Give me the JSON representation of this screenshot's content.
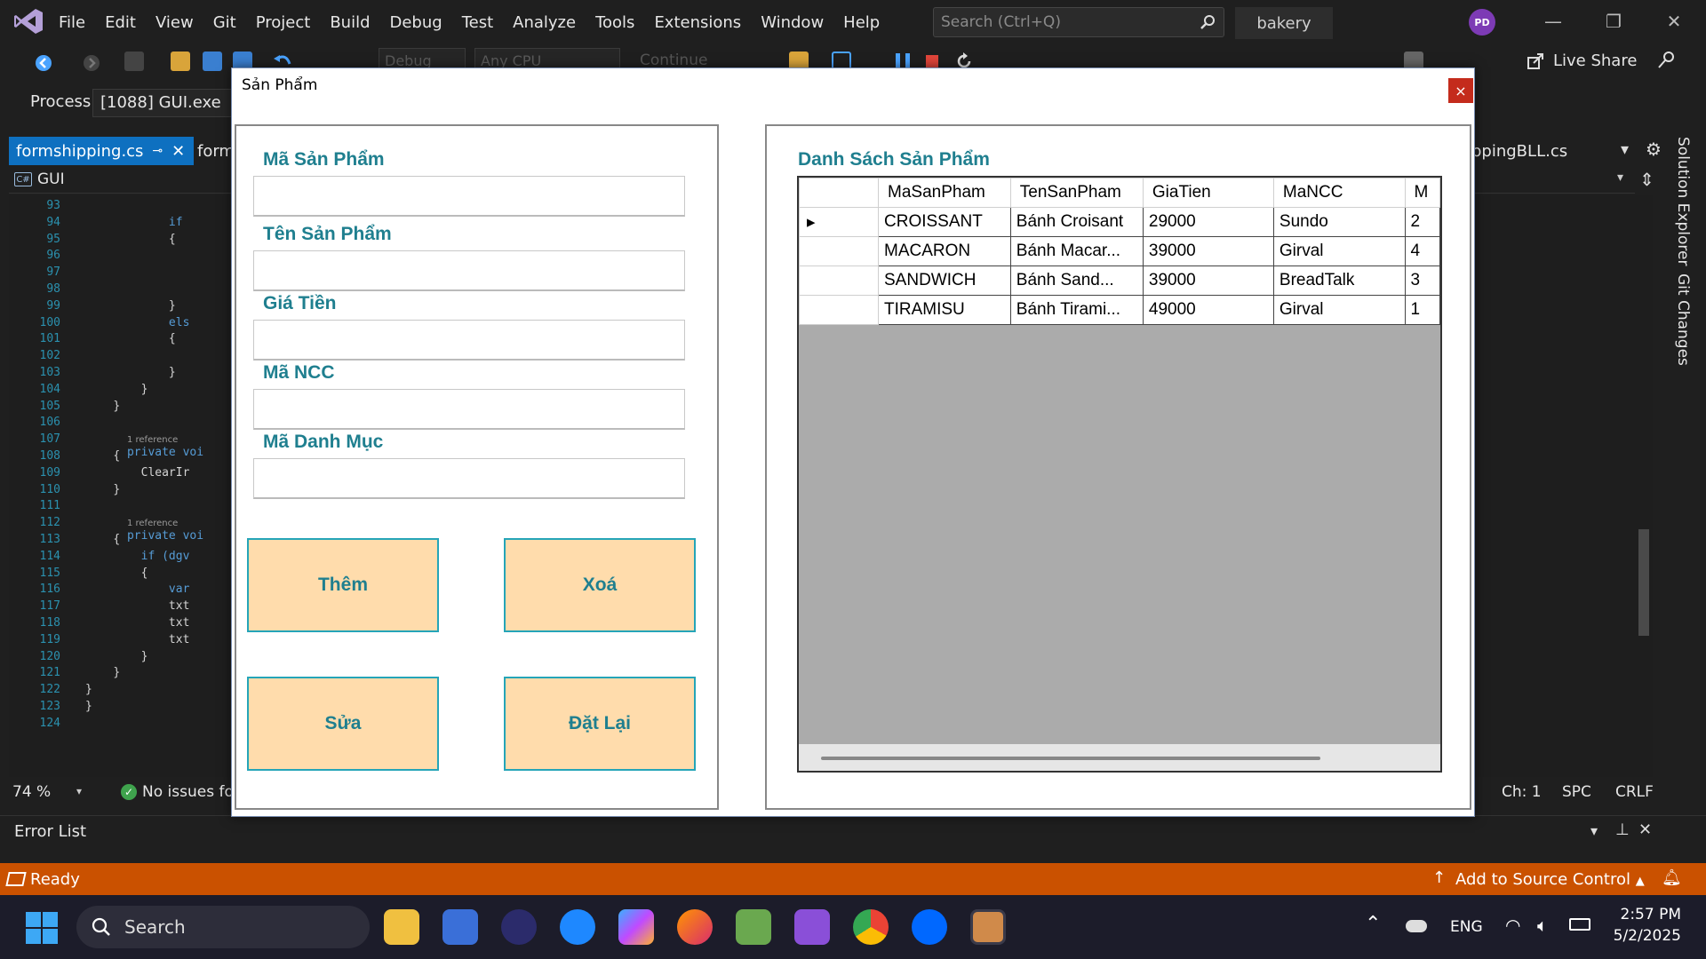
{
  "vs": {
    "menu": [
      "File",
      "Edit",
      "View",
      "Git",
      "Project",
      "Build",
      "Debug",
      "Test",
      "Analyze",
      "Tools",
      "Extensions",
      "Window",
      "Help"
    ],
    "search_placeholder": "Search (Ctrl+Q)",
    "solution_name": "bakery",
    "avatar_initials": "PD",
    "live_share": "Live Share",
    "toolbar_debug_combo": "Debug",
    "toolbar_cpu_combo": "Any CPU",
    "toolbar_continue": "Continue",
    "process_label": "Process:",
    "process_value": "[1088] GUI.exe",
    "active_tab": "formshipping.cs",
    "second_tab": "form",
    "right_tab": "ppingBLL.cs",
    "nav_project": "GUI",
    "line_numbers": [
      "93",
      "94",
      "95",
      "96",
      "97",
      "98",
      "99",
      "100",
      "101",
      "102",
      "103",
      "104",
      "105",
      "106",
      "107",
      "108",
      "109",
      "110",
      "111",
      "112",
      "113",
      "114",
      "115",
      "116",
      "117",
      "118",
      "119",
      "120",
      "121",
      "122",
      "123",
      "124"
    ],
    "code_fragments": {
      "if": "if",
      "else": "els",
      "reference": "1 reference",
      "private_void": "private voi",
      "clear": "ClearIr",
      "if_dgv": "if (dgv",
      "var": "var",
      "txt": "txt",
      "brace_open": "{",
      "brace_close": "}"
    },
    "zoom": "74 %",
    "no_issues": "No issues fou",
    "status_col": "Ch: 1",
    "status_spc": "SPC",
    "status_crlf": "CRLF",
    "side_tabs": [
      "Solution Explorer",
      "Git Changes"
    ],
    "error_list": "Error List",
    "status_ready": "Ready",
    "add_to_source_control": "Add to Source Control"
  },
  "taskbar": {
    "search": "Search",
    "lang": "ENG",
    "time": "2:57 PM",
    "date": "5/2/2025"
  },
  "dialog": {
    "title": "Sản Phẩm",
    "close": "×",
    "labels": {
      "ma_san_pham": "Mã Sản Phẩm",
      "ten_san_pham": "Tên Sản Phẩm",
      "gia_tien": "Giá Tiền",
      "ma_ncc": "Mã NCC",
      "ma_danh_muc": "Mã Danh Mục"
    },
    "inputs": {
      "ma_san_pham": "",
      "ten_san_pham": "",
      "gia_tien": "",
      "ma_ncc": "",
      "ma_danh_muc": ""
    },
    "buttons": {
      "them": "Thêm",
      "xoa": "Xoá",
      "sua": "Sửa",
      "dat_lai": "Đặt Lại"
    },
    "list_title": "Danh Sách Sản Phẩm",
    "grid": {
      "columns": [
        "MaSanPham",
        "TenSanPham",
        "GiaTien",
        "MaNCC",
        "M"
      ],
      "rows": [
        [
          "CROISSANT",
          "Bánh Croisant",
          "29000",
          "Sundo",
          "2"
        ],
        [
          "MACARON",
          "Bánh Macar...",
          "39000",
          "Girval",
          "4"
        ],
        [
          "SANDWICH",
          "Bánh Sand...",
          "39000",
          "BreadTalk",
          "3"
        ],
        [
          "TIRAMISU",
          "Bánh Tirami...",
          "49000",
          "Girval",
          "1"
        ]
      ],
      "current_row_marker": "▸"
    }
  },
  "colors": {
    "accent": "#0e70c0",
    "status_bar": "#ca5100",
    "form_label": "#1f7f8f",
    "button_fill": "#ffdcac",
    "button_border": "#25a5b8"
  }
}
